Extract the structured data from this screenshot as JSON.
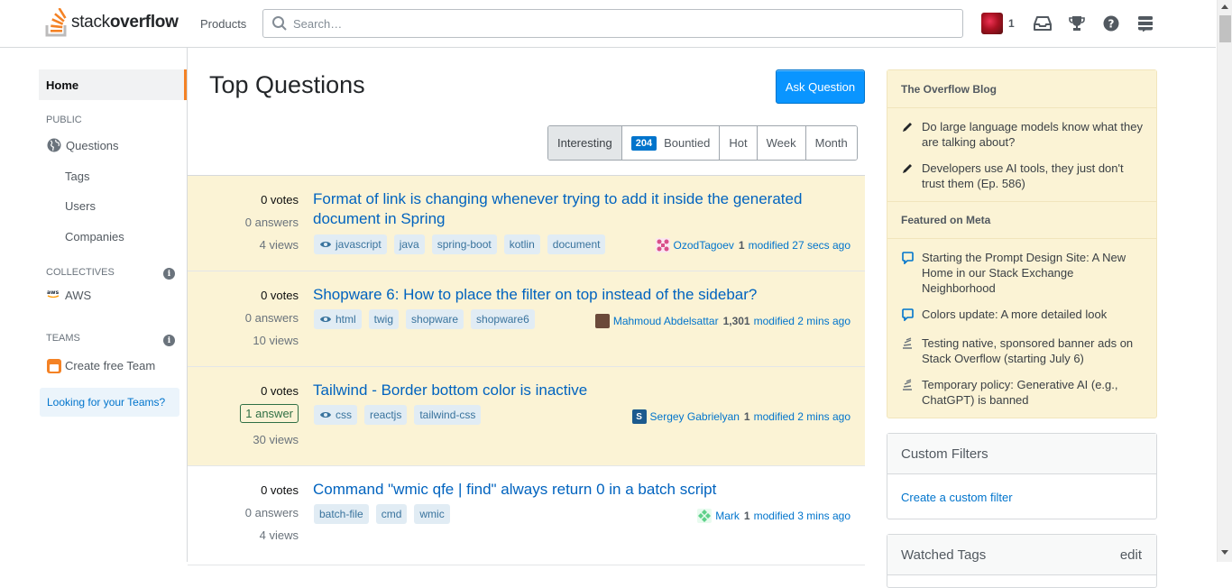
{
  "header": {
    "logo_light": "stack",
    "logo_bold": "overflow",
    "products_label": "Products",
    "search_placeholder": "Search…",
    "user_reputation": "1",
    "brand_color": "#f48225"
  },
  "leftnav": {
    "home": "Home",
    "public_label": "PUBLIC",
    "questions": "Questions",
    "tags": "Tags",
    "users": "Users",
    "companies": "Companies",
    "collectives_label": "COLLECTIVES",
    "aws": "AWS",
    "teams_label": "TEAMS",
    "create_team": "Create free Team",
    "looking_teams": "Looking for your Teams?"
  },
  "main": {
    "title": "Top Questions",
    "ask_button": "Ask Question",
    "filters": [
      {
        "label": "Interesting",
        "active": true
      },
      {
        "label": "Bountied",
        "badge": "204"
      },
      {
        "label": "Hot"
      },
      {
        "label": "Week"
      },
      {
        "label": "Month"
      }
    ],
    "questions": [
      {
        "votes": "0 votes",
        "answers": "0 answers",
        "views": "4 views",
        "title": "Format of link is changing whenever trying to add it inside the generated document in Spring",
        "tags": [
          "javascript",
          "java",
          "spring-boot",
          "kotlin",
          "document"
        ],
        "user": "OzodTagoev",
        "rep": "1",
        "modified": "modified 27 secs ago",
        "avatar_color": "#d94f8a",
        "watched": true
      },
      {
        "votes": "0 votes",
        "answers": "0 answers",
        "views": "10 views",
        "title": "Shopware 6: How to place the filter on top instead of the sidebar?",
        "tags": [
          "html",
          "twig",
          "shopware",
          "shopware6"
        ],
        "user": "Mahmoud Abdelsattar",
        "rep": "1,301",
        "modified": "modified 2 mins ago",
        "avatar_color": "#6b4a3a",
        "watched": true
      },
      {
        "votes": "0 votes",
        "answers": "1 answer",
        "views": "30 views",
        "title": "Tailwind - Border bottom color is inactive",
        "tags": [
          "css",
          "reactjs",
          "tailwind-css"
        ],
        "user": "Sergey Gabrielyan",
        "rep": "1",
        "modified": "modified 2 mins ago",
        "avatar_color": "#1c5a8e",
        "avatar_letter": "S",
        "watched": true
      },
      {
        "votes": "0 votes",
        "answers": "0 answers",
        "views": "4 views",
        "title": "Command \"wmic qfe | find\" always return 0 in a batch script",
        "tags": [
          "batch-file",
          "cmd",
          "wmic"
        ],
        "user": "Mark",
        "rep": "1",
        "modified": "modified 3 mins ago",
        "avatar_color": "#5fd18a",
        "watched": false
      }
    ]
  },
  "sidebar": {
    "blog_title": "The Overflow Blog",
    "blog_items": [
      "Do large language models know what they are talking about?",
      "Developers use AI tools, they just don't trust them (Ep. 586)"
    ],
    "meta_title": "Featured on Meta",
    "meta_items": [
      "Starting the Prompt Design Site: A New Home in our Stack Exchange Neighborhood",
      "Colors update: A more detailed look",
      "Testing native, sponsored banner ads on Stack Overflow (starting July 6)",
      "Temporary policy: Generative AI (e.g., ChatGPT) is banned"
    ],
    "custom_filters_title": "Custom Filters",
    "create_filter": "Create a custom filter",
    "watched_tags_title": "Watched Tags",
    "edit": "edit"
  }
}
